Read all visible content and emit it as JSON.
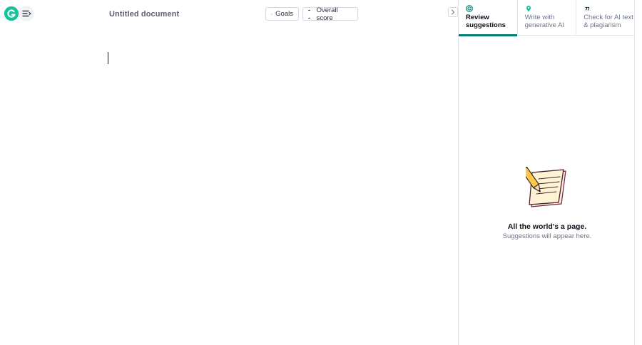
{
  "header": {
    "document_title": "Untitled document",
    "goals_label": "Goals",
    "score_value": "--",
    "score_label": "Overall score"
  },
  "sidebar": {
    "tabs": [
      {
        "label": "Review suggestions",
        "icon": "grammarly-g-icon",
        "active": true
      },
      {
        "label": "Write with generative AI",
        "icon": "location-pin-icon",
        "active": false
      },
      {
        "label": "Check for AI text & plagiarism",
        "icon": "quote-icon",
        "active": false
      }
    ],
    "empty_state": {
      "title": "All the world's a page.",
      "subtitle": "Suggestions will appear here.",
      "illustration": "notepad-pencil-icon"
    }
  },
  "colors": {
    "brand": "#15c39a",
    "active_tab_underline": "#027e6f",
    "muted_text": "#6d758d",
    "title_text": "#5c6075"
  }
}
